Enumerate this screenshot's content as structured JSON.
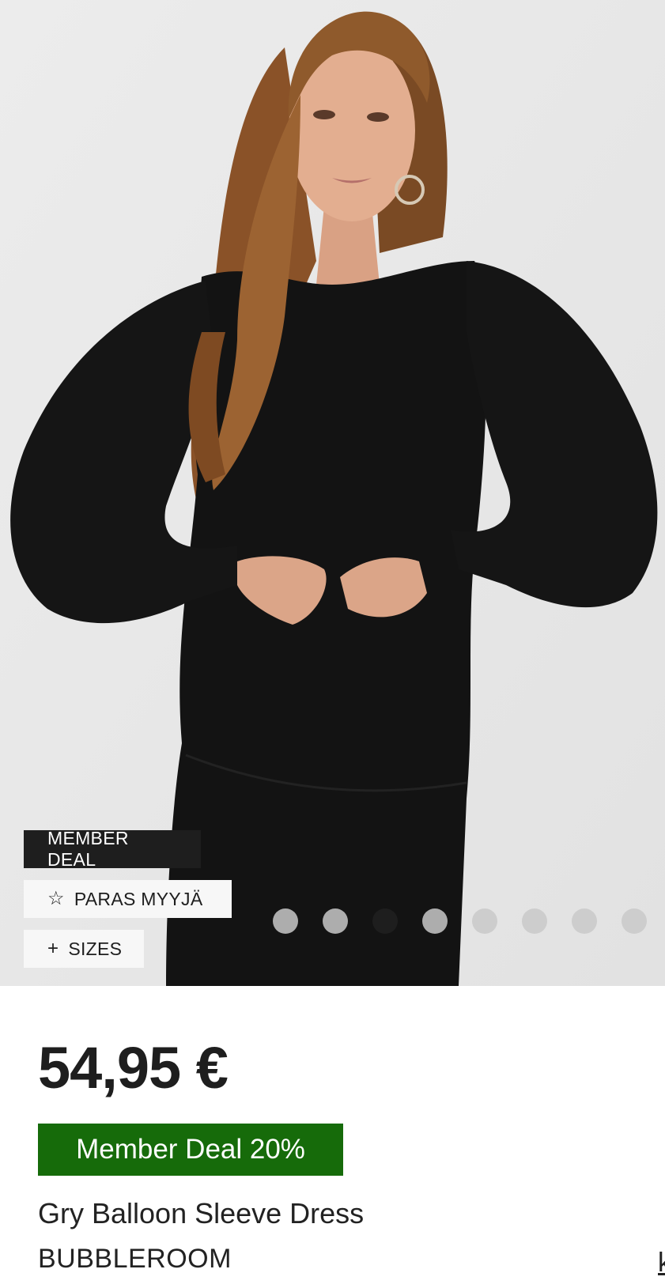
{
  "gallery": {
    "image_alt": "model-wearing-black-balloon-sleeve-dress",
    "current_slide": 3,
    "total_slides": 8,
    "tags": {
      "member_deal": "MEMBER DEAL",
      "bestseller_icon": "star-outline-icon",
      "bestseller": "PARAS MYYJÄ",
      "sizes_icon": "plus-icon",
      "sizes": "SIZES"
    }
  },
  "product": {
    "price": "54,95 €",
    "member_badge": "Member Deal 20%",
    "name": "Gry Balloon Sleeve Dress",
    "brand": "BUBBLEROOM",
    "next_item_fragment": "k"
  },
  "colors": {
    "hero_background": "#e9e9e9",
    "dress": "#121212",
    "member_badge": "#166b0a",
    "tag_dark": "#1e1e1e",
    "tag_light": "#f7f7f7",
    "dot_active": "#1e1e1e",
    "dot_inactive": "#c9c9c9"
  }
}
